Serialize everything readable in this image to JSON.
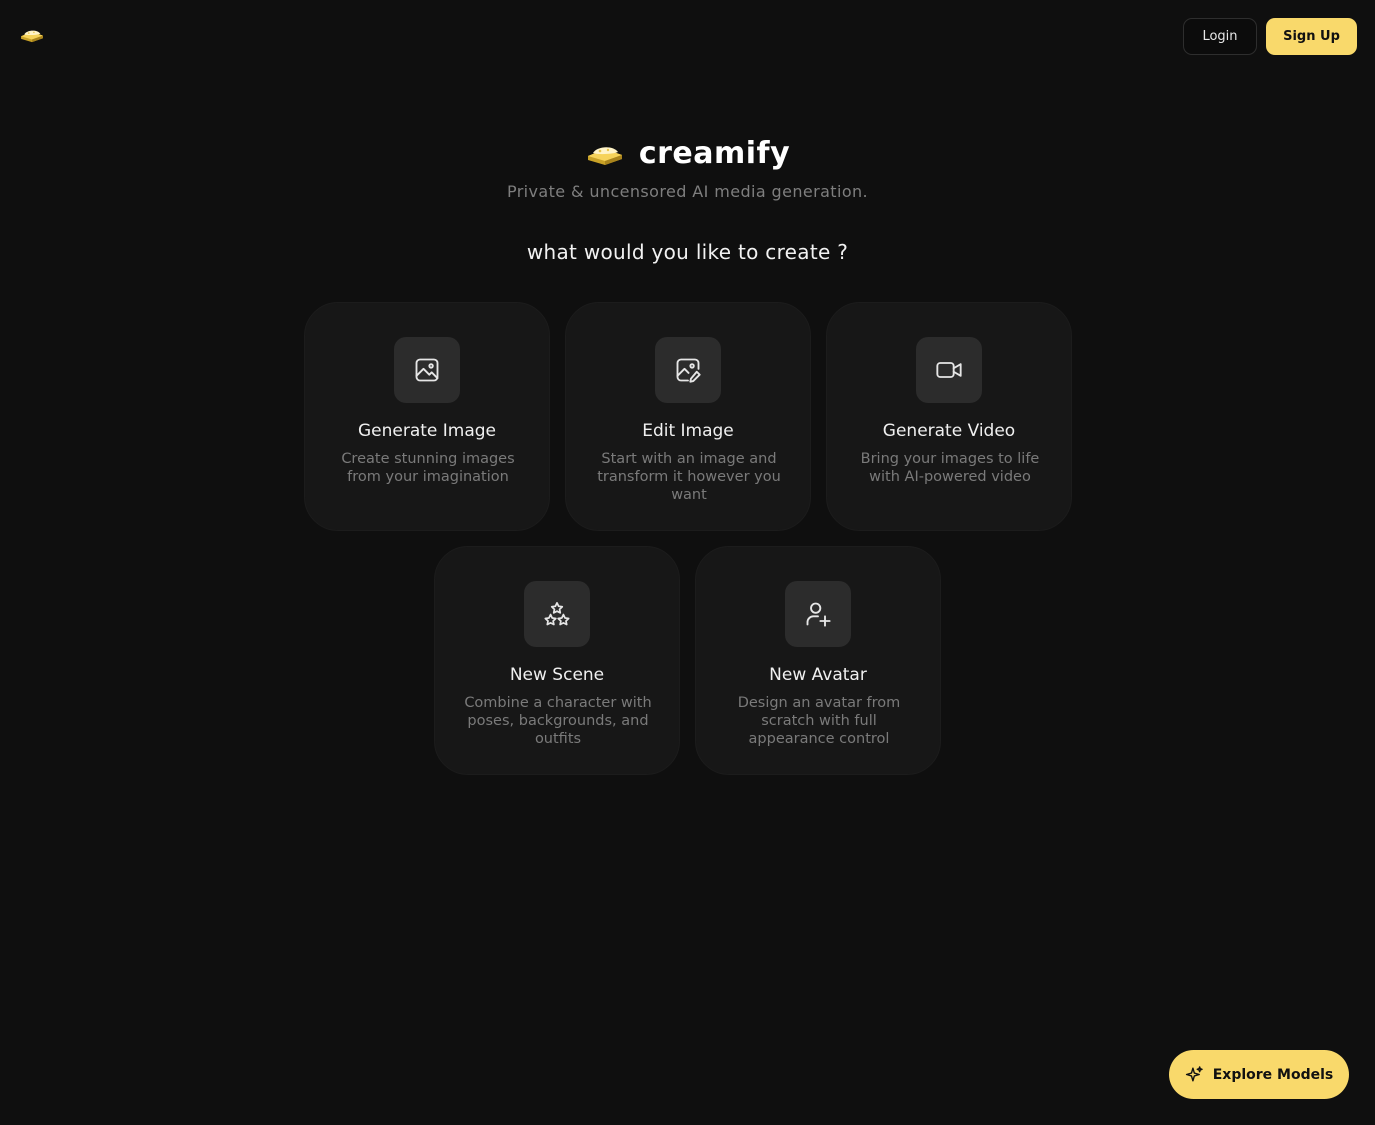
{
  "header": {
    "logo_icon": "cream-sponge-logo-icon",
    "login_label": "Login",
    "signup_label": "Sign Up"
  },
  "hero": {
    "brand_name": "creamify",
    "tagline": "Private & uncensored AI media generation.",
    "prompt": "what would you like to create ?"
  },
  "cards": [
    {
      "title": "Generate Image",
      "description": "Create stunning images from your imagination",
      "icon": "image-icon"
    },
    {
      "title": "Edit Image",
      "description": "Start with an image and transform it however you want",
      "icon": "image-edit-icon"
    },
    {
      "title": "Generate Video",
      "description": "Bring your images to life with AI-powered video",
      "icon": "video-camera-icon"
    },
    {
      "title": "New Scene",
      "description": "Combine a character with poses, backgrounds, and outfits",
      "icon": "stars-icon"
    },
    {
      "title": "New Avatar",
      "description": "Design an avatar from scratch with full appearance control",
      "icon": "user-plus-icon"
    }
  ],
  "explore": {
    "label": "Explore Models",
    "icon": "sparkles-icon"
  },
  "colors": {
    "background": "#0f0f0f",
    "card": "#171717",
    "accent": "#f9d96b"
  }
}
